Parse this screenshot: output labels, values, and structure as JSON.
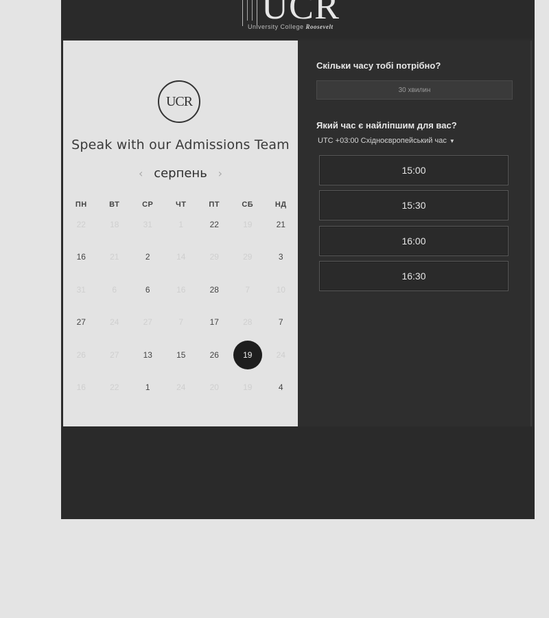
{
  "header": {
    "logo_text": "UCR",
    "logo_subtitle": "University College",
    "logo_subtitle_script": "Roosevelt"
  },
  "calendar": {
    "badge_text": "UCR",
    "title": "Speak with our Admissions Team",
    "month": "серпень",
    "prev_icon": "chevron-left-icon",
    "next_icon": "chevron-right-icon",
    "weekdays": [
      "ПН",
      "ВТ",
      "СР",
      "ЧТ",
      "ПТ",
      "СБ",
      "НД"
    ],
    "weeks": [
      [
        {
          "d": "22",
          "a": false
        },
        {
          "d": "18",
          "a": false
        },
        {
          "d": "31",
          "a": false
        },
        {
          "d": "1",
          "a": false
        },
        {
          "d": "22",
          "a": true
        },
        {
          "d": "19",
          "a": false
        },
        {
          "d": "21",
          "a": true
        }
      ],
      [
        {
          "d": "16",
          "a": true
        },
        {
          "d": "21",
          "a": false
        },
        {
          "d": "2",
          "a": true
        },
        {
          "d": "14",
          "a": false
        },
        {
          "d": "29",
          "a": false
        },
        {
          "d": "29",
          "a": false
        },
        {
          "d": "3",
          "a": true
        }
      ],
      [
        {
          "d": "31",
          "a": false
        },
        {
          "d": "6",
          "a": false
        },
        {
          "d": "6",
          "a": true
        },
        {
          "d": "16",
          "a": false
        },
        {
          "d": "28",
          "a": true
        },
        {
          "d": "7",
          "a": false
        },
        {
          "d": "10",
          "a": false
        }
      ],
      [
        {
          "d": "27",
          "a": true
        },
        {
          "d": "24",
          "a": false
        },
        {
          "d": "27",
          "a": false
        },
        {
          "d": "7",
          "a": false
        },
        {
          "d": "17",
          "a": true
        },
        {
          "d": "28",
          "a": false
        },
        {
          "d": "7",
          "a": true
        }
      ],
      [
        {
          "d": "26",
          "a": false
        },
        {
          "d": "27",
          "a": false
        },
        {
          "d": "13",
          "a": true
        },
        {
          "d": "15",
          "a": true
        },
        {
          "d": "26",
          "a": true
        },
        {
          "d": "19",
          "a": true,
          "selected": true
        },
        {
          "d": "24",
          "a": false
        }
      ],
      [
        {
          "d": "16",
          "a": false
        },
        {
          "d": "22",
          "a": false
        },
        {
          "d": "1",
          "a": true
        },
        {
          "d": "24",
          "a": false
        },
        {
          "d": "20",
          "a": false
        },
        {
          "d": "19",
          "a": false
        },
        {
          "d": "4",
          "a": true
        }
      ]
    ]
  },
  "booking": {
    "duration_question": "Скільки часу тобі потрібно?",
    "duration_value": "30 хвилин",
    "time_question": "Який час є найліпшим для вас?",
    "timezone": "UTC +03:00 Східноєвропейський час",
    "slots": [
      "15:00",
      "15:30",
      "16:00",
      "16:30"
    ]
  },
  "colors": {
    "page_bg": "#e4e4e4",
    "dark_panel": "#2e2e2e",
    "light_panel": "#e3e3e3",
    "selected_day": "#1e1e1e"
  }
}
